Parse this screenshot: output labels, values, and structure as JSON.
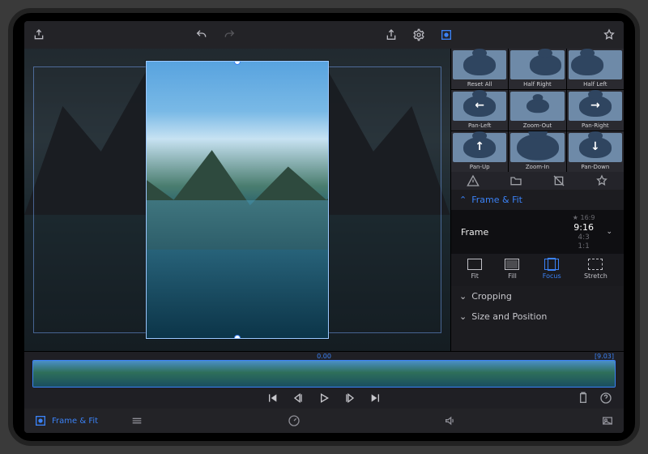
{
  "toolbar": {
    "export_icon": "export",
    "undo_icon": "undo",
    "redo_icon": "redo",
    "share_icon": "share",
    "settings_icon": "settings",
    "frame_fit_icon": "frame-fit",
    "star_icon": "star"
  },
  "presets": [
    {
      "label": "Reset All",
      "arrow": ""
    },
    {
      "label": "Half Right",
      "arrow": ""
    },
    {
      "label": "Half Left",
      "arrow": ""
    },
    {
      "label": "Pan-Left",
      "arrow": "←"
    },
    {
      "label": "Zoom-Out",
      "arrow": ""
    },
    {
      "label": "Pan-Right",
      "arrow": "→"
    },
    {
      "label": "Pan-Up",
      "arrow": "↑"
    },
    {
      "label": "Zoom-In",
      "arrow": ""
    },
    {
      "label": "Pan-Down",
      "arrow": "↓"
    }
  ],
  "panel": {
    "section_title": "Frame & Fit",
    "frame_label": "Frame",
    "ratios": {
      "r1": "16:9",
      "r2_selected": "9:16",
      "r3": "4:3",
      "r4": "1:1"
    },
    "fit_modes": {
      "fit": "Fit",
      "fill": "Fill",
      "focus": "Focus",
      "stretch": "Stretch"
    },
    "cropping": "Cropping",
    "size_pos": "Size and Position"
  },
  "timeline": {
    "current_time": "0.00",
    "end_time": "[9.03]"
  },
  "bottom": {
    "frame_fit": "Frame & Fit"
  }
}
